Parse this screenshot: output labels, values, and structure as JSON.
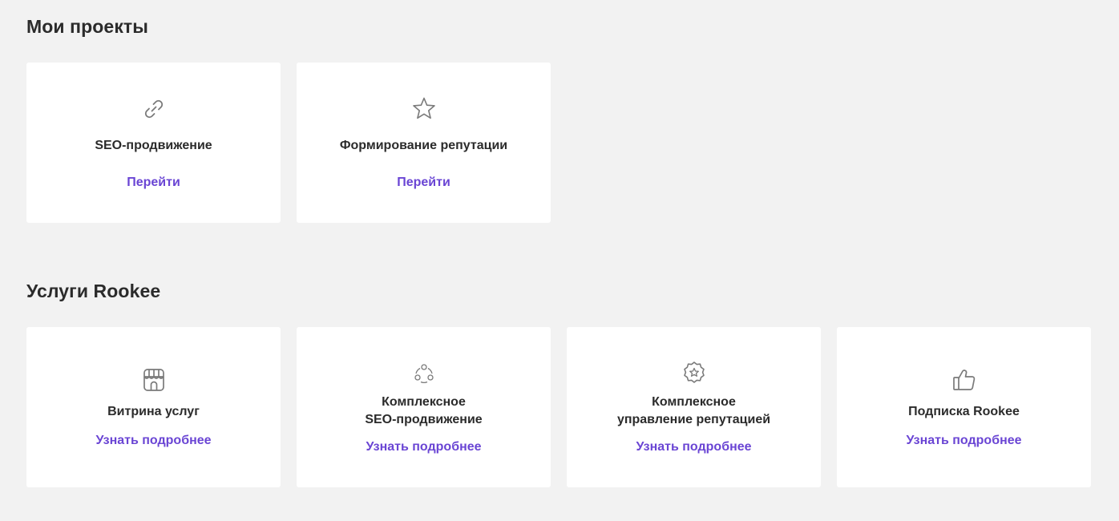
{
  "projects": {
    "title": "Мои проекты",
    "cards": [
      {
        "icon": "link-icon",
        "title": "SEO-продвижение",
        "link": "Перейти"
      },
      {
        "icon": "star-icon",
        "title": "Формирование репутации",
        "link": "Перейти"
      }
    ]
  },
  "services": {
    "title": "Услуги Rookee",
    "cards": [
      {
        "icon": "storefront-icon",
        "title": "Витрина услуг",
        "link": "Узнать подробнее"
      },
      {
        "icon": "cycle-icon",
        "title": "Комплексное\nSEO-продвижение",
        "link": "Узнать подробнее"
      },
      {
        "icon": "badge-star-icon",
        "title": "Комплексное\nуправление репутацией",
        "link": "Узнать подробнее"
      },
      {
        "icon": "thumbs-up-icon",
        "title": "Подписка Rookee",
        "link": "Узнать подробнее"
      }
    ]
  },
  "colors": {
    "accent": "#6a45d4",
    "background": "#f2f2f2",
    "card": "#ffffff",
    "text": "#2b2b2b",
    "icon": "#7a7a7a"
  }
}
